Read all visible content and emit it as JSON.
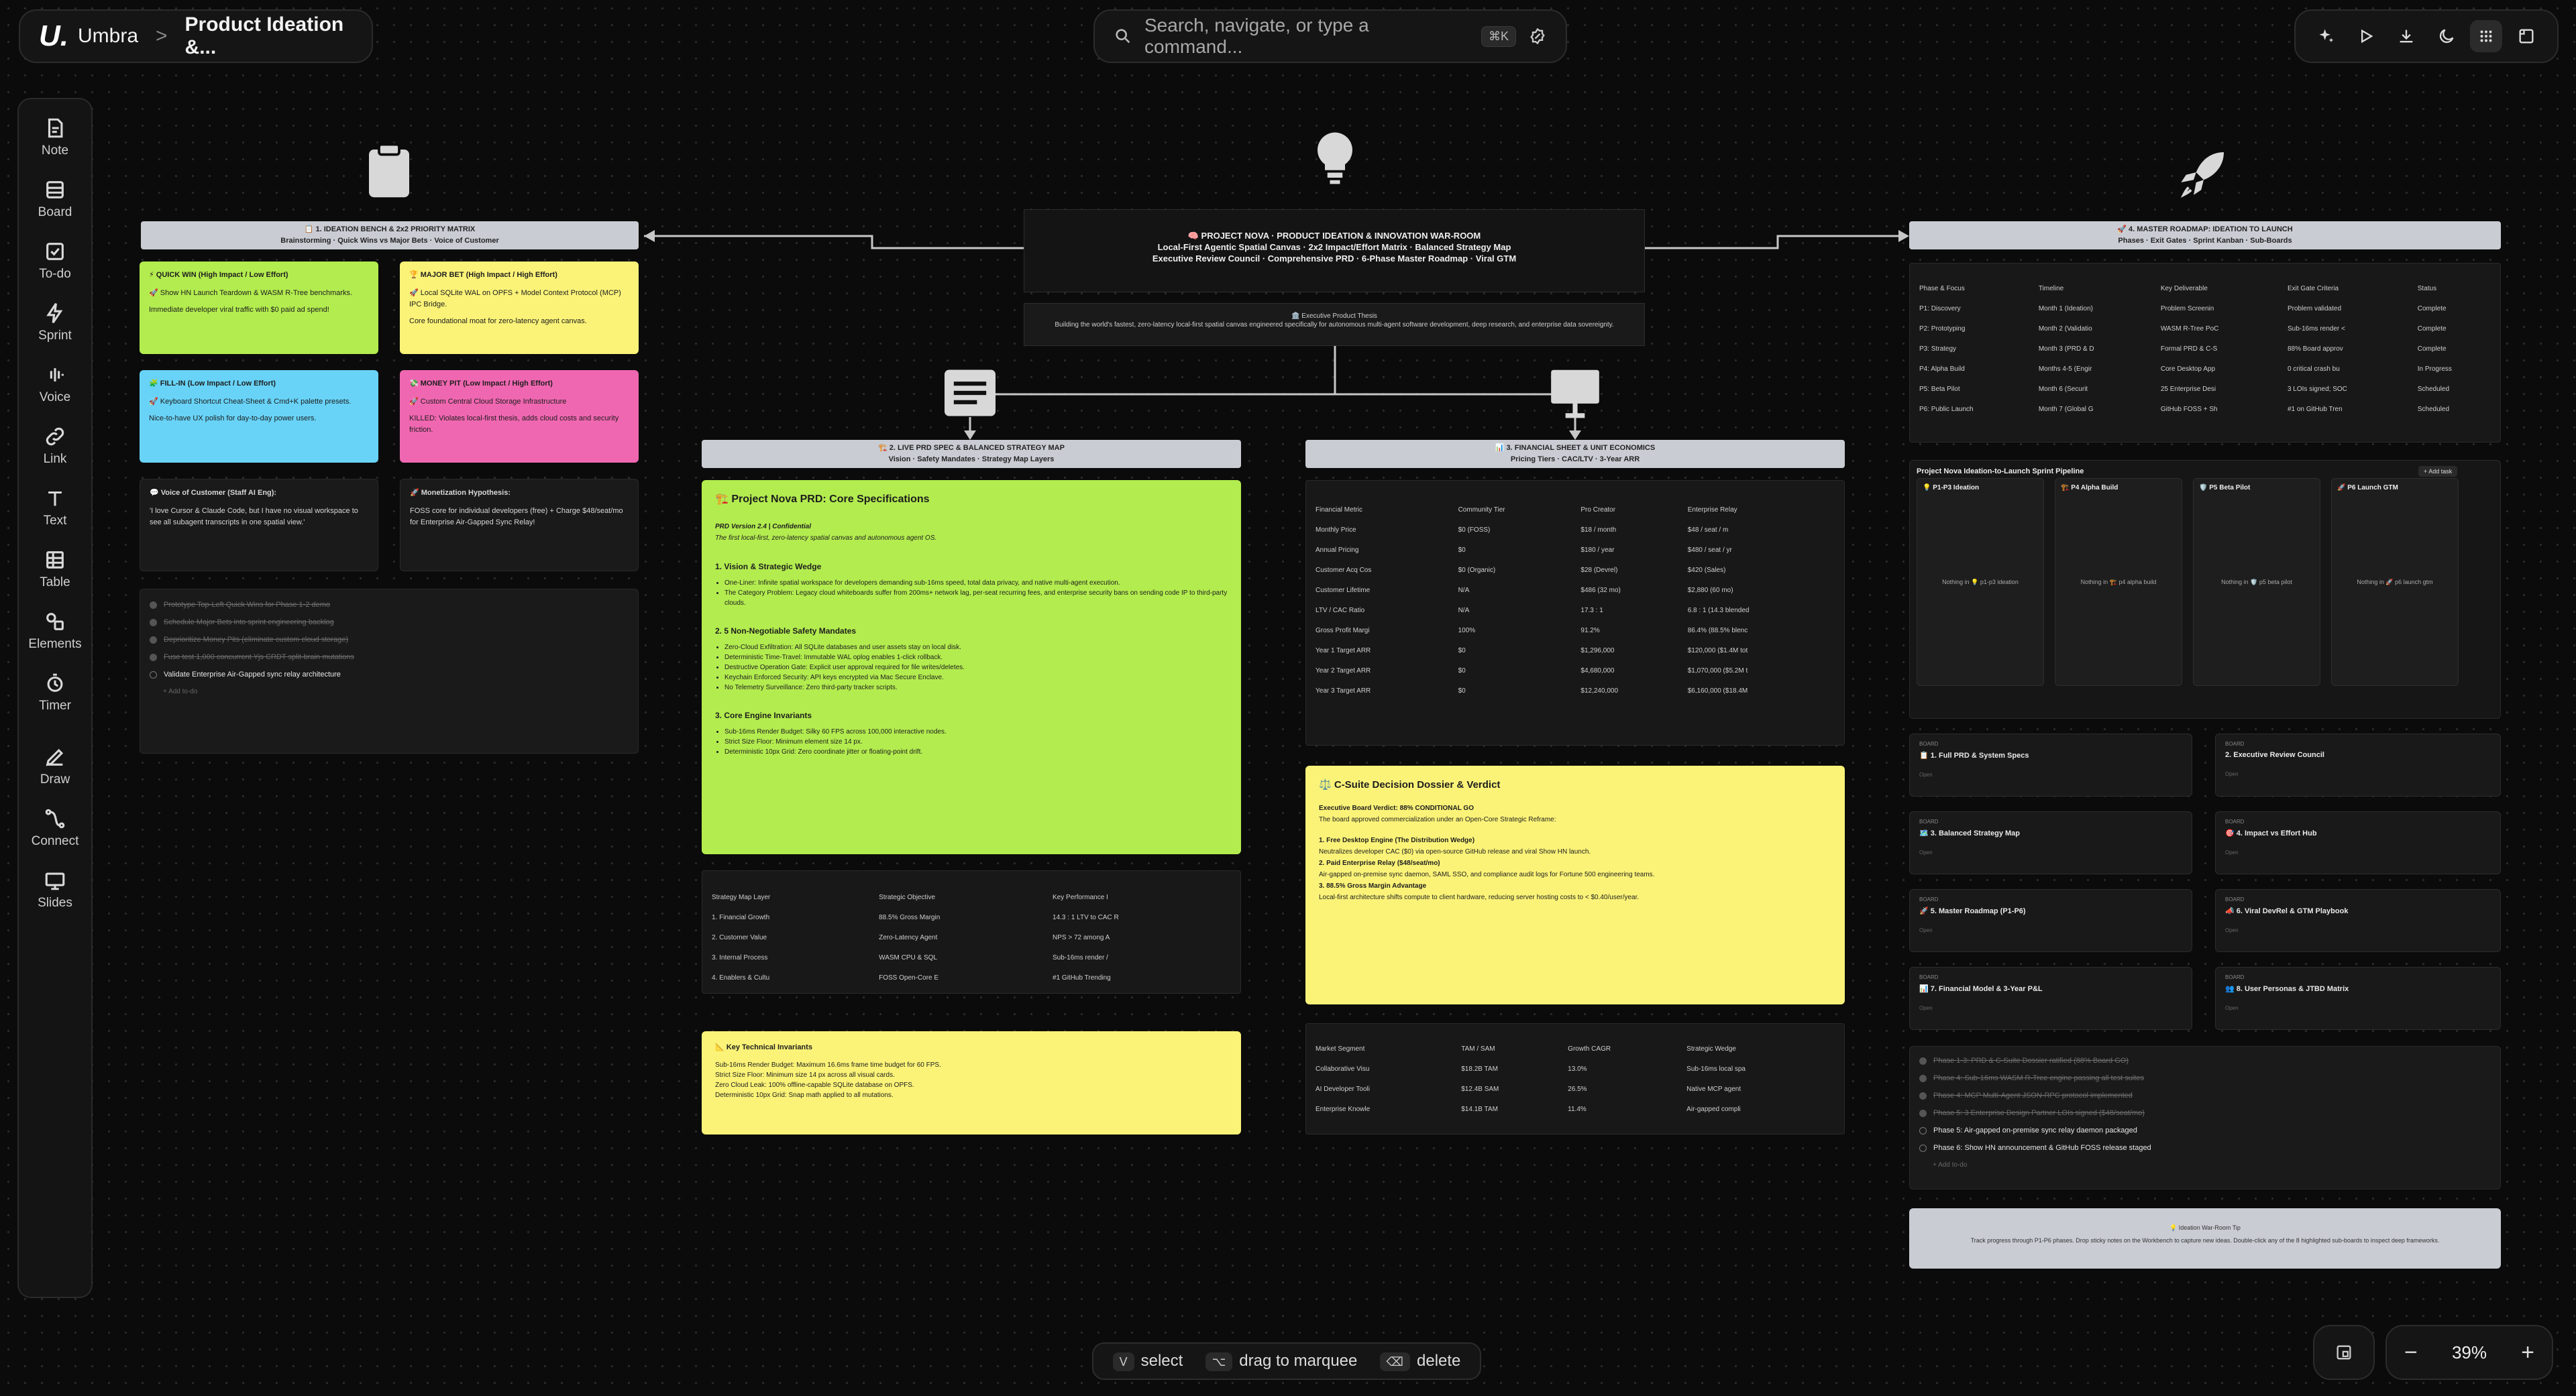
{
  "app": {
    "logo": "U.",
    "name": "Umbra",
    "breadcrumb_sep": ">",
    "project": "Product Ideation &..."
  },
  "search": {
    "placeholder": "Search, navigate, or type a command...",
    "shortcut": "⌘K"
  },
  "tools": [
    {
      "label": "Note",
      "icon": "note-icon"
    },
    {
      "label": "Board",
      "icon": "board-icon"
    },
    {
      "label": "To-do",
      "icon": "todo-icon"
    },
    {
      "label": "Sprint",
      "icon": "sprint-icon"
    },
    {
      "label": "Voice",
      "icon": "voice-icon"
    },
    {
      "label": "Link",
      "icon": "link-icon"
    },
    {
      "label": "Text",
      "icon": "text-icon"
    },
    {
      "label": "Table",
      "icon": "table-icon"
    },
    {
      "label": "Elements",
      "icon": "elements-icon"
    },
    {
      "label": "Timer",
      "icon": "timer-icon"
    },
    {
      "label": "Draw",
      "icon": "draw-icon"
    },
    {
      "label": "Connect",
      "icon": "connect-icon"
    },
    {
      "label": "Slides",
      "icon": "slides-icon"
    }
  ],
  "hints": {
    "select_key": "V",
    "select": "select",
    "drag_key": "⌥",
    "drag": "drag to marquee",
    "delete_key": "⌫",
    "delete": "delete"
  },
  "zoom": {
    "value": "39%",
    "minus": "−",
    "plus": "+"
  },
  "main": {
    "title1": "🧠 PROJECT NOVA · PRODUCT IDEATION & INNOVATION WAR-ROOM",
    "title2": "Local-First Agentic Spatial Canvas · 2x2 Impact/Effort Matrix · Balanced Strategy Map",
    "title3": "Executive Review Council · Comprehensive PRD · 6-Phase Master Roadmap · Viral GTM",
    "thesis_head": "🏛️ Executive Product Thesis",
    "thesis": "Building the world's fastest, zero-latency local-first spatial canvas engineered specifically for autonomous multi-agent software development, deep research, and enterprise data sovereignty."
  },
  "bench": {
    "h1": "📋 1. IDEATION BENCH & 2x2 PRIORITY MATRIX",
    "h2": "Brainstorming · Quick Wins vs Major Bets · Voice of Customer",
    "qw_t": "⚡ QUICK WIN (High Impact / Low Effort)",
    "qw_1": "🚀 Show HN Launch Teardown & WASM R-Tree benchmarks.",
    "qw_2": "Immediate developer viral traffic with $0 paid ad spend!",
    "mb_t": "🏆 MAJOR BET (High Impact / High Effort)",
    "mb_1": "🚀 Local SQLite WAL on OPFS + Model Context Protocol (MCP) IPC Bridge.",
    "mb_2": "Core foundational moat for zero-latency agent canvas.",
    "fi_t": "🧩 FILL-IN (Low Impact / Low Effort)",
    "fi_1": "🚀 Keyboard Shortcut Cheat-Sheet & Cmd+K palette presets.",
    "fi_2": "Nice-to-have UX polish for day-to-day power users.",
    "mp_t": "💸 MONEY PIT (Low Impact / High Effort)",
    "mp_1": "🚀 Custom Central Cloud Storage Infrastructure",
    "mp_2": "KILLED: Violates local-first thesis, adds cloud costs and security friction.",
    "voc_t": "💬 Voice of Customer (Staff AI Eng):",
    "voc": "'I love Cursor & Claude Code, but I have no visual workspace to see all subagent transcripts in one spatial view.'",
    "mon_t": "🚀 Monetization Hypothesis:",
    "mon": "FOSS core for individual developers (free) + Charge $48/seat/mo for Enterprise Air-Gapped Sync Relay!",
    "todos": [
      "Prototype Top-Left Quick Wins for Phase 1-2 demo",
      "Schedule Major Bets into sprint engineering backlog",
      "Deprioritize Money Pits (eliminate custom cloud storage)",
      "Fuse test 1,000 concurrent Yjs CRDT split-brain mutations"
    ],
    "todo_live": "Validate Enterprise Air-Gapped sync relay architecture",
    "add": "+ Add to-do"
  },
  "prd": {
    "h1": "🏗️ 2. LIVE PRD SPEC & BALANCED STRATEGY MAP",
    "h2": "Vision · Safety Mandates · Strategy Map Layers",
    "title": "🏗️ Project Nova PRD: Core Specifications",
    "ver": "PRD Version 2.4 | Confidential",
    "tag": "The first local-first, zero-latency spatial canvas and autonomous agent OS.",
    "s1": "1. Vision & Strategic Wedge",
    "s1a": "One-Liner: Infinite spatial workspace for developers demanding sub-16ms speed, total data privacy, and native multi-agent execution.",
    "s1b": "The Category Problem: Legacy cloud whiteboards suffer from 200ms+ network lag, per-seat recurring fees, and enterprise security bans on sending code IP to third-party clouds.",
    "s2": "2. 5 Non-Negotiable Safety Mandates",
    "m1": "Zero-Cloud Exfiltration: All SQLite databases and user assets stay on local disk.",
    "m2": "Deterministic Time-Travel: Immutable WAL oplog enables 1-click rollback.",
    "m3": "Destructive Operation Gate: Explicit user approval required for file writes/deletes.",
    "m4": "Keychain Enforced Security: API keys encrypted via Mac Secure Enclave.",
    "m5": "No Telemetry Surveillance: Zero third-party tracker scripts.",
    "s3": "3. Core Engine Invariants",
    "i1": "Sub-16ms Render Budget: Silky 60 FPS across 100,000 interactive nodes.",
    "i2": "Strict Size Floor: Minimum element size 14 px.",
    "i3": "Deterministic 10px Grid: Zero coordinate jitter or floating-point drift.",
    "map_head": [
      "Strategy Map Layer",
      "Strategic Objective",
      "Key Performance I"
    ],
    "map_rows": [
      [
        "1. Financial Growth",
        "88.5% Gross Margin",
        "14.3 : 1 LTV to CAC R"
      ],
      [
        "2. Customer Value",
        "Zero-Latency Agent",
        "NPS > 72 among A"
      ],
      [
        "3. Internal Process",
        "WASM CPU & SQL",
        "Sub-16ms render /"
      ],
      [
        "4. Enablers & Cultu",
        "FOSS Open-Core E",
        "#1 GitHub Trending"
      ]
    ],
    "inv_t": "📐 Key Technical Invariants",
    "inv1": "Sub-16ms Render Budget: Maximum 16.6ms frame time budget for 60 FPS.",
    "inv2": "Strict Size Floor: Minimum size 14 px across all visual cards.",
    "inv3": "Zero Cloud Leak: 100% offline-capable SQLite database on OPFS.",
    "inv4": "Deterministic 10px Grid: Snap math applied to all mutations."
  },
  "fin": {
    "h1": "📊 3. FINANCIAL SHEET & UNIT ECONOMICS",
    "h2": "Pricing Tiers · CAC/LTV · 3-Year ARR",
    "head": [
      "Financial Metric",
      "Community Tier",
      "Pro Creator",
      "Enterprise Relay"
    ],
    "rows": [
      [
        "Monthly Price",
        "$0 (FOSS)",
        "$18 / month",
        "$48 / seat / m"
      ],
      [
        "Annual Pricing",
        "$0",
        "$180 / year",
        "$480 / seat / yr"
      ],
      [
        "Customer Acq Cos",
        "$0 (Organic)",
        "$28 (Devrel)",
        "$420 (Sales)"
      ],
      [
        "Customer Lifetime",
        "N/A",
        "$486 (32 mo)",
        "$2,880 (60 mo)"
      ],
      [
        "LTV / CAC Ratio",
        "N/A",
        "17.3 : 1",
        "6.8 : 1 (14.3 blended"
      ],
      [
        "Gross Profit Margi",
        "100%",
        "91.2%",
        "86.4% (88.5% blenc"
      ],
      [
        "Year 1 Target ARR",
        "$0",
        "$1,296,000",
        "$120,000 ($1.4M tot"
      ],
      [
        "Year 2 Target ARR",
        "$0",
        "$4,680,000",
        "$1,070,000 ($5.2M t"
      ],
      [
        "Year 3 Target ARR",
        "$0",
        "$12,240,000",
        "$6,160,000 ($18.4M"
      ]
    ],
    "dv_t": "⚖️ C-Suite Decision Dossier & Verdict",
    "dv_v": "Executive Board Verdict: 88% CONDITIONAL GO",
    "dv_1": "The board approved commercialization under an Open-Core Strategic Reframe:",
    "dv_a": "1. Free Desktop Engine (The Distribution Wedge)",
    "dv_a2": "Neutralizes developer CAC ($0) via open-source GitHub release and viral Show HN launch.",
    "dv_b": "2. Paid Enterprise Relay ($48/seat/mo)",
    "dv_b2": "Air-gapped on-premise sync daemon, SAML SSO, and compliance audit logs for Fortune 500 engineering teams.",
    "dv_c": "3. 88.5% Gross Margin Advantage",
    "dv_c2": "Local-first architecture shifts compute to client hardware, reducing server hosting costs to < $0.40/user/year.",
    "tam_head": [
      "Market Segment",
      "TAM / SAM",
      "Growth CAGR",
      "Strategic Wedge"
    ],
    "tam_rows": [
      [
        "Collaborative Visu",
        "$18.2B TAM",
        "13.0%",
        "Sub-16ms local spa"
      ],
      [
        "AI Developer Tooli",
        "$12.4B SAM",
        "26.5%",
        "Native MCP agent"
      ],
      [
        "Enterprise Knowle",
        "$14.1B TAM",
        "11.4%",
        "Air-gapped compli"
      ]
    ]
  },
  "road": {
    "h1": "🚀 4. MASTER ROADMAP: IDEATION TO LAUNCH",
    "h2": "Phases · Exit Gates · Sprint Kanban · Sub-Boards",
    "head": [
      "Phase & Focus",
      "Timeline",
      "Key Deliverable",
      "Exit Gate Criteria",
      "Status"
    ],
    "rows": [
      [
        "P1: Discovery",
        "Month 1 (Ideation)",
        "Problem Screenin",
        "Problem validated",
        "Complete"
      ],
      [
        "P2: Prototyping",
        "Month 2 (Validatio",
        "WASM R-Tree PoC",
        "Sub-16ms render <",
        "Complete"
      ],
      [
        "P3: Strategy",
        "Month 3 (PRD & D",
        "Formal PRD & C-S",
        "88% Board approv",
        "Complete"
      ],
      [
        "P4: Alpha Build",
        "Months 4-5 (Engir",
        "Core Desktop App",
        "0 critical crash bu",
        "In Progress"
      ],
      [
        "P5: Beta Pilot",
        "Month 6 (Securit",
        "25 Enterprise Desi",
        "3 LOIs signed; SOC",
        "Scheduled"
      ],
      [
        "P6: Public Launch",
        "Month 7 (Global G",
        "GitHub FOSS + Sh",
        "#1 on GitHub Tren",
        "Scheduled"
      ]
    ],
    "pipe_t": "Project Nova Ideation-to-Launch Sprint Pipeline",
    "add_task": "+ Add task",
    "cols": [
      {
        "h": "💡 P1-P3 Ideation",
        "e": "Nothing in 💡 p1-p3 ideation"
      },
      {
        "h": "🏗️ P4 Alpha Build",
        "e": "Nothing in 🏗️ p4 alpha build"
      },
      {
        "h": "🛡️ P5 Beta Pilot",
        "e": "Nothing in 🛡️ p5 beta pilot"
      },
      {
        "h": "🚀 P6 Launch GTM",
        "e": "Nothing in 🚀 p6 launch gtm"
      }
    ],
    "boards": [
      "📋 1. Full PRD & System Specs",
      "2. Executive Review Council",
      "🗺️ 3. Balanced Strategy Map",
      "🎯 4. Impact vs Effort Hub",
      "🚀 5. Master Roadmap (P1-P6)",
      "📣 6. Viral DevRel & GTM Playbook",
      "📊 7. Financial Model & 3-Year P&L",
      "👥 8. User Personas & JTBD Matrix"
    ],
    "board_kind": "BOARD",
    "board_open": "Open",
    "todos": [
      "Phase 1-3: PRD & C-Suite Dossier ratified (88% Board GO)",
      "Phase 4: Sub-16ms WASM R-Tree engine passing all test suites",
      "Phase 4: MCP Multi-Agent JSON-RPC protocol implemented",
      "Phase 5: 3 Enterprise Design Partner LOIs signed ($48/seat/mo)"
    ],
    "live": [
      "Phase 5: Air-gapped on-premise sync relay daemon packaged",
      "Phase 6: Show HN announcement & GitHub FOSS release staged"
    ],
    "add": "+ Add to-do",
    "tip_t": "💡 Ideation War-Room Tip",
    "tip": "Track progress through P1-P6 phases. Drop sticky notes on the Workbench to capture new ideas. Double-click any of the 8 highlighted sub-boards to inspect deep frameworks."
  },
  "colors": {
    "green": "#b3ec4f",
    "yellow": "#fbf378",
    "cyan": "#68d3f7",
    "pink": "#f067b1",
    "header": "#c9ccd3"
  }
}
